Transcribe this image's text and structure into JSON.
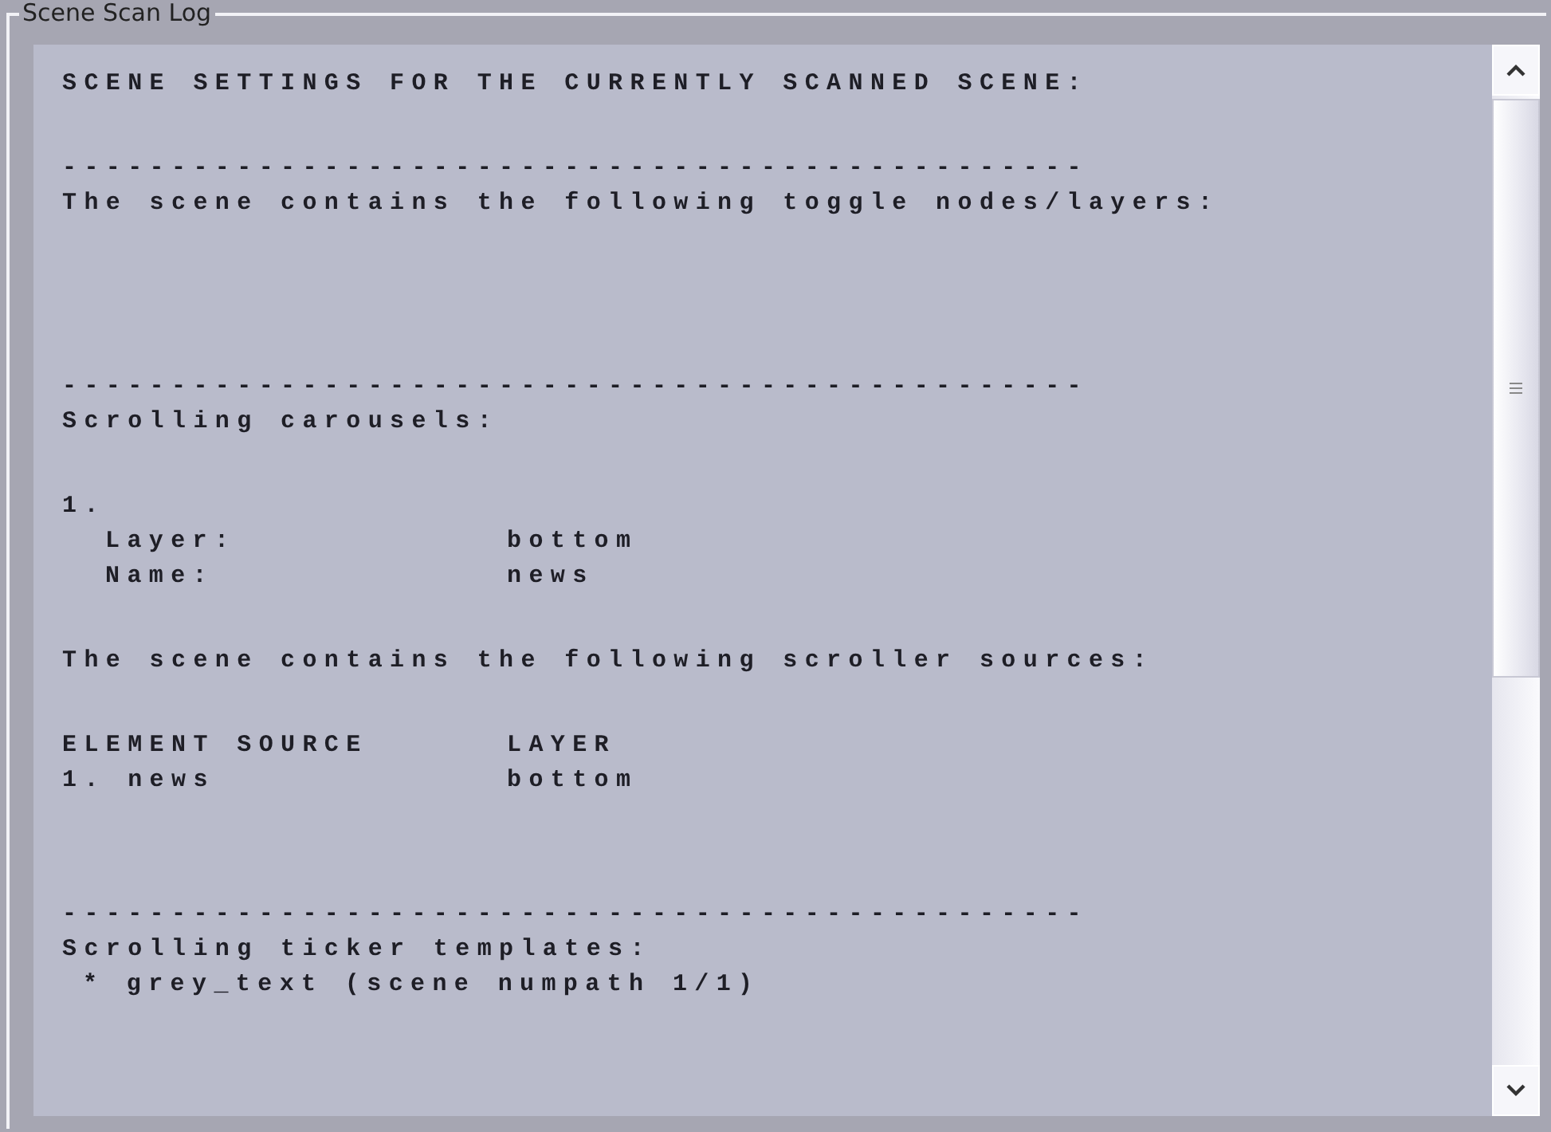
{
  "group_box": {
    "title": "Scene Scan Log"
  },
  "log": {
    "lines": [
      {
        "kind": "text",
        "text": "SCENE SETTINGS FOR THE CURRENTLY SCANNED SCENE:"
      },
      {
        "kind": "blank"
      },
      {
        "kind": "rule",
        "text": "-----------------------------------------------"
      },
      {
        "kind": "text",
        "text": "The scene contains the following toggle nodes/layers:"
      },
      {
        "kind": "blank"
      },
      {
        "kind": "blank"
      },
      {
        "kind": "blank"
      },
      {
        "kind": "rule",
        "text": "-----------------------------------------------"
      },
      {
        "kind": "text",
        "text": "Scrolling carousels:"
      },
      {
        "kind": "blank"
      },
      {
        "kind": "text",
        "text": "1."
      },
      {
        "kind": "field",
        "label": "Layer:",
        "value": "bottom"
      },
      {
        "kind": "field",
        "label": "Name:",
        "value": "news"
      },
      {
        "kind": "blank"
      },
      {
        "kind": "text",
        "text": "The scene contains the following scroller sources:"
      },
      {
        "kind": "blank"
      },
      {
        "kind": "columns",
        "col_1": "ELEMENT SOURCE",
        "col_2": "LAYER"
      },
      {
        "kind": "columns",
        "col_1": "1. news",
        "col_2": "bottom"
      },
      {
        "kind": "blank"
      },
      {
        "kind": "blank"
      },
      {
        "kind": "rule",
        "text": "-----------------------------------------------"
      },
      {
        "kind": "text",
        "text": "Scrolling ticker templates:"
      },
      {
        "kind": "bullet",
        "text": "* grey_text (scene numpath 1/1)"
      }
    ]
  }
}
